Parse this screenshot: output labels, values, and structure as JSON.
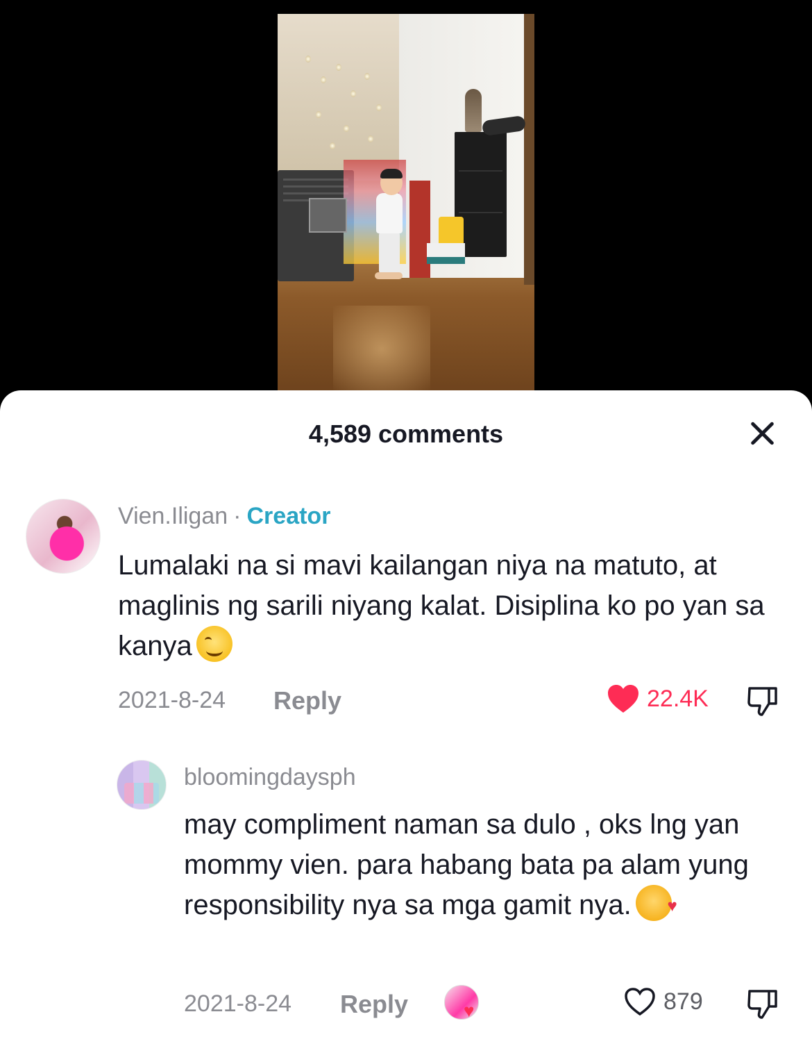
{
  "sheet": {
    "comment_count": "4,589 comments"
  },
  "comments": [
    {
      "username": "Vien.Iligan",
      "separator": "·",
      "badge": "Creator",
      "text": "Lumalaki na si mavi kailangan niya na matuto, at maglinis ng sarili niyang kalat. Disiplina ko po yan sa kanya",
      "emoji": "smiling-face-icon",
      "date": "2021-8-24",
      "reply_label": "Reply",
      "likes": "22.4K",
      "liked": true
    },
    {
      "username": "bloomingdaysph",
      "text": "may compliment naman sa dulo , oks lng yan mommy vien. para habang bata pa alam yung responsibility nya sa mga gamit nya.",
      "emoji": "smiling-face-with-hearts-icon",
      "date": "2021-8-24",
      "reply_label": "Reply",
      "likes": "879",
      "liked": false
    }
  ],
  "colors": {
    "accent_creator": "#2aa5c4",
    "like_red": "#fe2c55",
    "text_primary": "#161823",
    "text_secondary": "#8a8b91"
  }
}
